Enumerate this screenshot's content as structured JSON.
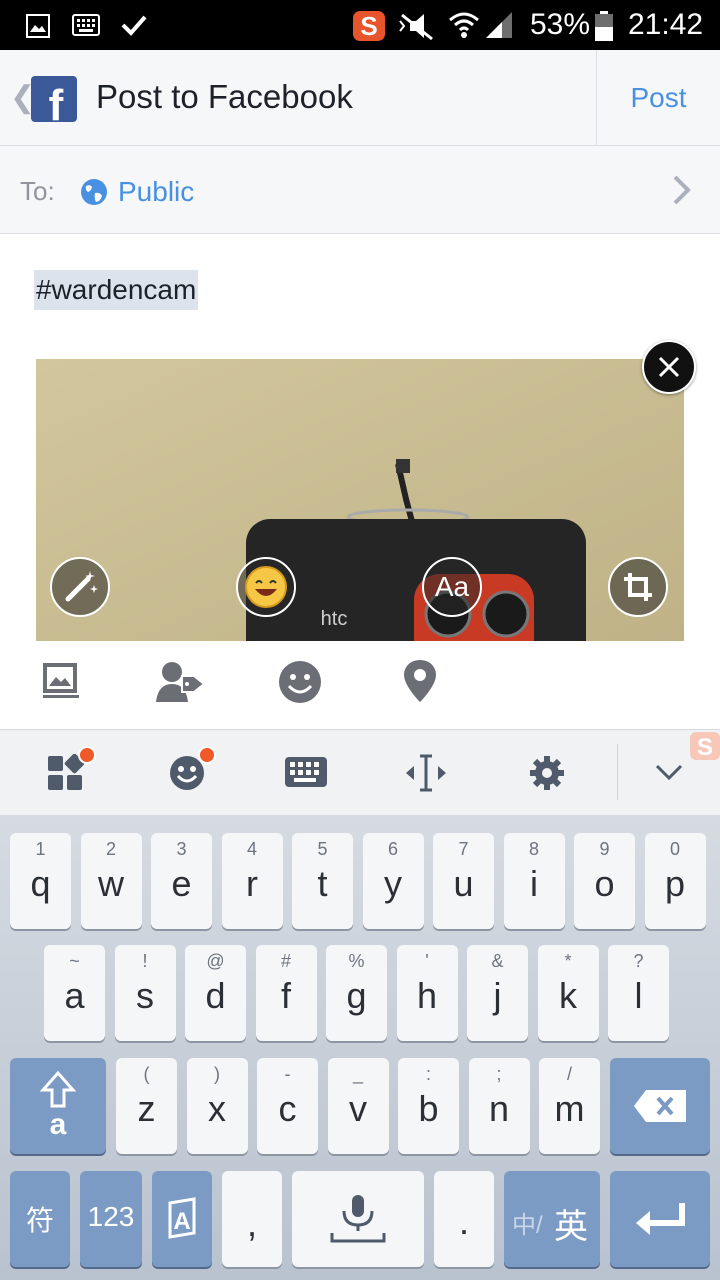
{
  "status_bar": {
    "battery": "53%",
    "time": "21:42"
  },
  "header": {
    "title": "Post to Facebook",
    "post_label": "Post"
  },
  "audience": {
    "to_label": "To:",
    "value": "Public"
  },
  "composer": {
    "text": "#wardencam",
    "text_tool_label": "Aa"
  },
  "photo_overlay_text": "htc",
  "keyboard": {
    "row1": [
      {
        "hint": "1",
        "key": "q"
      },
      {
        "hint": "2",
        "key": "w"
      },
      {
        "hint": "3",
        "key": "e"
      },
      {
        "hint": "4",
        "key": "r"
      },
      {
        "hint": "5",
        "key": "t"
      },
      {
        "hint": "6",
        "key": "y"
      },
      {
        "hint": "7",
        "key": "u"
      },
      {
        "hint": "8",
        "key": "i"
      },
      {
        "hint": "9",
        "key": "o"
      },
      {
        "hint": "0",
        "key": "p"
      }
    ],
    "row2": [
      {
        "hint": "~",
        "key": "a"
      },
      {
        "hint": "!",
        "key": "s"
      },
      {
        "hint": "@",
        "key": "d"
      },
      {
        "hint": "#",
        "key": "f"
      },
      {
        "hint": "%",
        "key": "g"
      },
      {
        "hint": "'",
        "key": "h"
      },
      {
        "hint": "&",
        "key": "j"
      },
      {
        "hint": "*",
        "key": "k"
      },
      {
        "hint": "?",
        "key": "l"
      }
    ],
    "row3": [
      {
        "hint": "(",
        "key": "z"
      },
      {
        "hint": ")",
        "key": "x"
      },
      {
        "hint": "-",
        "key": "c"
      },
      {
        "hint": "_",
        "key": "v"
      },
      {
        "hint": ":",
        "key": "b"
      },
      {
        "hint": ";",
        "key": "n"
      },
      {
        "hint": "/",
        "key": "m"
      }
    ],
    "symbols_label": "符",
    "numbers_label": "123",
    "comma_label": ",",
    "period_label": ".",
    "lang_label_a": "中/",
    "lang_label_b": "英",
    "shift_sub": "a"
  },
  "colors": {
    "facebook_blue": "#3b5998",
    "link_blue": "#4a90e2",
    "notification": "#f05a28"
  }
}
